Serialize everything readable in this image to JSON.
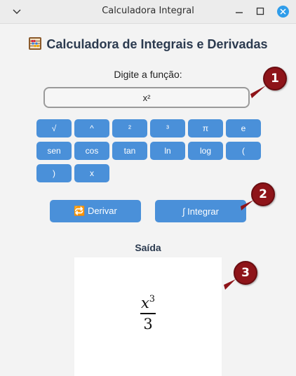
{
  "window": {
    "title": "Calculadora Integral"
  },
  "app": {
    "title": "Calculadora de Integrais e Derivadas",
    "icon": "abacus-icon",
    "function_label": "Digite a função:",
    "function_value": "x²"
  },
  "keypad": {
    "keys": [
      "√",
      "^",
      "²",
      "³",
      "π",
      "e",
      "sen",
      "cos",
      "tan",
      "ln",
      "log",
      "(",
      ")",
      "x"
    ]
  },
  "actions": {
    "derivar_label": "🔁 Derivar",
    "integrar_label": "∫ Integrar"
  },
  "output": {
    "label": "Saída",
    "numerator_var": "x",
    "numerator_exp": "3",
    "denominator": "3"
  },
  "badges": {
    "one": "1",
    "two": "2",
    "three": "3"
  },
  "colors": {
    "button": "#4a90d9",
    "title_text": "#2b3a4f",
    "badge": "#8e1419",
    "close_button": "#2f9dea"
  }
}
